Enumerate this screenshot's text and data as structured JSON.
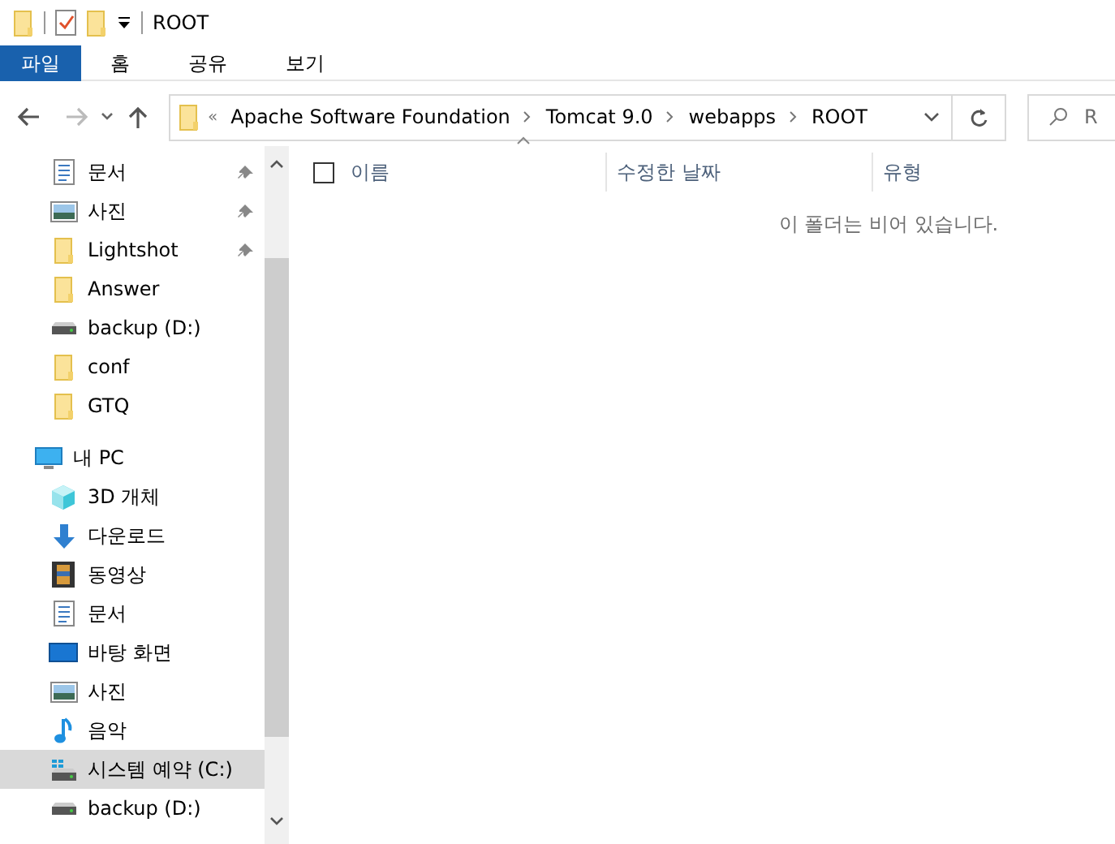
{
  "title_bar": {
    "title": "ROOT"
  },
  "ribbon_tabs": [
    {
      "label": "파일",
      "selected": true
    },
    {
      "label": "홈",
      "selected": false
    },
    {
      "label": "공유",
      "selected": false
    },
    {
      "label": "보기",
      "selected": false
    }
  ],
  "address_bar": {
    "overflow": "«",
    "crumbs": [
      "Apache Software Foundation",
      "Tomcat 9.0",
      "webapps",
      "ROOT"
    ]
  },
  "search": {
    "placeholder": "R"
  },
  "nav": {
    "quick_access": [
      {
        "label": "문서",
        "kind": "document",
        "pinned": true,
        "selected": false
      },
      {
        "label": "사진",
        "kind": "picture",
        "pinned": true,
        "selected": false
      },
      {
        "label": "Lightshot",
        "kind": "folder",
        "pinned": true,
        "selected": false
      },
      {
        "label": "Answer",
        "kind": "folder",
        "pinned": false,
        "selected": false
      },
      {
        "label": "backup (D:)",
        "kind": "drive",
        "pinned": false,
        "selected": false
      },
      {
        "label": "conf",
        "kind": "folder",
        "pinned": false,
        "selected": false
      },
      {
        "label": "GTQ",
        "kind": "folder",
        "pinned": false,
        "selected": false
      }
    ],
    "this_pc": {
      "label": "내 PC",
      "kind": "pc",
      "selected": false,
      "children": [
        {
          "label": "3D 개체",
          "kind": "cube",
          "selected": false
        },
        {
          "label": "다운로드",
          "kind": "download",
          "selected": false
        },
        {
          "label": "동영상",
          "kind": "video",
          "selected": false
        },
        {
          "label": "문서",
          "kind": "document",
          "selected": false
        },
        {
          "label": "바탕 화면",
          "kind": "desktop",
          "selected": false
        },
        {
          "label": "사진",
          "kind": "picture",
          "selected": false
        },
        {
          "label": "음악",
          "kind": "music",
          "selected": false
        },
        {
          "label": "시스템 예약 (C:)",
          "kind": "sysdrive",
          "selected": true
        },
        {
          "label": "backup (D:)",
          "kind": "drive",
          "selected": false
        }
      ]
    }
  },
  "select_all": {
    "checked": false
  },
  "columns": [
    {
      "label": "이름"
    },
    {
      "label": "수정한 날짜"
    },
    {
      "label": "유형"
    }
  ],
  "empty_message": "이 폴더는 비어 있습니다."
}
